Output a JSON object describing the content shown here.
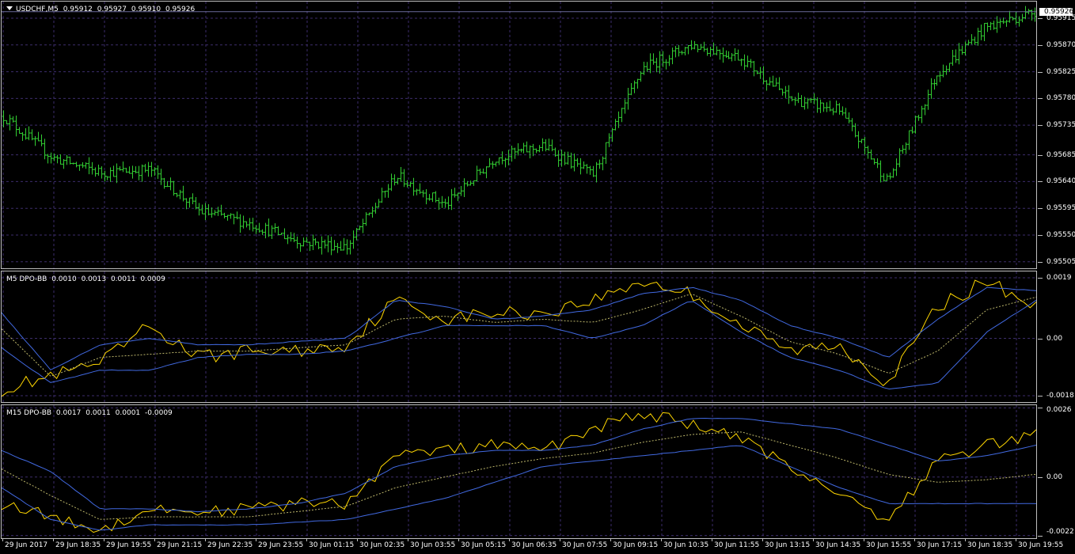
{
  "colors": {
    "background": "#000000",
    "grid": "#3c2d6b",
    "bar": "#32cd32",
    "dpo": "#ffd700",
    "band": "#4169e1",
    "mid": "#bdb76b",
    "frame": "#bfbfbf"
  },
  "main": {
    "symbol_label": "USDCHF,M5",
    "ohlc": [
      "0.95912",
      "0.95927",
      "0.95910",
      "0.95926"
    ],
    "current_price_label": "0.95926",
    "current_price": 0.95926,
    "yticks": [
      "0.95915",
      "0.95870",
      "0.95825",
      "0.95780",
      "0.95735",
      "0.95685",
      "0.95640",
      "0.95595",
      "0.95550",
      "0.95505"
    ],
    "yrange": [
      0.95494,
      0.95943
    ]
  },
  "ind1": {
    "label": "M5 DPO-BB",
    "values": [
      "0.0010",
      "0.0013",
      "0.0011",
      "0.0009"
    ],
    "yticks": [
      "0.0019",
      "0.00",
      "-0.0018"
    ],
    "yrange": [
      -0.002,
      0.0021
    ]
  },
  "ind2": {
    "label": "M15 DPO-BB",
    "values": [
      "0.0017",
      "0.0011",
      "0.0001",
      "-0.0009"
    ],
    "yticks": [
      "0.0026",
      "0.00",
      "-0.0022"
    ],
    "yrange": [
      -0.0023,
      0.0027
    ]
  },
  "xaxis": [
    "29 Jun 2017",
    "29 Jun 18:35",
    "29 Jun 19:55",
    "29 Jun 21:15",
    "29 Jun 22:35",
    "29 Jun 23:55",
    "30 Jun 01:15",
    "30 Jun 02:35",
    "30 Jun 03:55",
    "30 Jun 05:15",
    "30 Jun 06:35",
    "30 Jun 07:55",
    "30 Jun 09:15",
    "30 Jun 10:35",
    "30 Jun 11:55",
    "30 Jun 13:15",
    "30 Jun 14:35",
    "30 Jun 15:55",
    "30 Jun 17:15",
    "30 Jun 18:35",
    "30 Jun 19:55"
  ],
  "chart_data": [
    {
      "type": "bar",
      "title": "USDCHF,M5",
      "x": [
        "29 Jun 2017",
        "29 Jun 18:35",
        "29 Jun 19:55",
        "29 Jun 21:15",
        "29 Jun 22:35",
        "29 Jun 23:55",
        "30 Jun 01:15",
        "30 Jun 02:35",
        "30 Jun 03:55",
        "30 Jun 05:15",
        "30 Jun 06:35",
        "30 Jun 07:55",
        "30 Jun 09:15",
        "30 Jun 10:35",
        "30 Jun 11:55",
        "30 Jun 13:15",
        "30 Jun 14:35",
        "30 Jun 15:55",
        "30 Jun 17:15",
        "30 Jun 18:35",
        "30 Jun 19:55"
      ],
      "close": [
        0.9575,
        0.9568,
        0.95655,
        0.9566,
        0.9559,
        0.9557,
        0.9554,
        0.9553,
        0.9565,
        0.956,
        0.9568,
        0.957,
        0.9565,
        0.9583,
        0.9587,
        0.9585,
        0.9578,
        0.9576,
        0.9564,
        0.9582,
        0.959,
        0.95926
      ],
      "ylim": [
        0.95494,
        0.95943
      ]
    },
    {
      "type": "line",
      "title": "M5 DPO-BB",
      "series": [
        {
          "name": "DPO",
          "values": [
            -0.0016,
            -0.0012,
            -0.0008,
            0.0004,
            -0.0006,
            -0.0004,
            -0.0004,
            -0.0002,
            0.0012,
            0.0006,
            0.0008,
            0.0008,
            0.0012,
            0.0018,
            0.0014,
            0.0004,
            -0.0004,
            -0.0002,
            -0.0014,
            0.001,
            0.0018,
            0.001
          ]
        },
        {
          "name": "Upper",
          "values": [
            0.0008,
            -0.001,
            -0.0002,
            0.0,
            -0.0002,
            -0.0002,
            -0.0001,
            0.0,
            0.0012,
            0.001,
            0.0006,
            0.0007,
            0.0009,
            0.0014,
            0.0016,
            0.0012,
            0.0004,
            0.0,
            -0.0006,
            0.0006,
            0.0016,
            0.0015
          ]
        },
        {
          "name": "Lower",
          "values": [
            -0.0003,
            -0.0014,
            -0.001,
            -0.001,
            -0.0006,
            -0.0005,
            -0.0005,
            -0.0004,
            0.0,
            0.0004,
            0.0004,
            0.0004,
            0.0,
            0.0004,
            0.0012,
            0.0002,
            -0.0006,
            -0.001,
            -0.0016,
            -0.0014,
            0.0002,
            0.0012
          ]
        },
        {
          "name": "Mid",
          "values": [
            0.0003,
            -0.0012,
            -0.0006,
            -0.0005,
            -0.0004,
            -0.0004,
            -0.0003,
            -0.0002,
            0.0006,
            0.0007,
            0.0005,
            0.0006,
            0.0005,
            0.0009,
            0.0014,
            0.0007,
            -0.0001,
            -0.0005,
            -0.0011,
            -0.0004,
            0.0009,
            0.0013
          ]
        }
      ],
      "ylim": [
        -0.002,
        0.0021
      ]
    },
    {
      "type": "line",
      "title": "M15 DPO-BB",
      "series": [
        {
          "name": "DPO",
          "values": [
            -0.001,
            -0.0015,
            -0.002,
            -0.0012,
            -0.0013,
            -0.0012,
            -0.001,
            -0.001,
            0.0008,
            0.001,
            0.0012,
            0.001,
            0.0018,
            0.0024,
            0.002,
            0.0014,
            0.0004,
            -0.0006,
            -0.0016,
            0.0006,
            0.0012,
            0.0016
          ]
        },
        {
          "name": "Upper",
          "values": [
            0.001,
            0.0002,
            -0.0012,
            -0.0012,
            -0.0013,
            -0.0012,
            -0.001,
            -0.0006,
            0.0004,
            0.0008,
            0.001,
            0.001,
            0.0012,
            0.0018,
            0.0022,
            0.0022,
            0.002,
            0.0018,
            0.0012,
            0.0006,
            0.0008,
            0.0012
          ]
        },
        {
          "name": "Lower",
          "values": [
            -0.0004,
            -0.0016,
            -0.002,
            -0.0018,
            -0.0018,
            -0.0018,
            -0.0017,
            -0.0016,
            -0.0012,
            -0.0008,
            -0.0002,
            0.0004,
            0.0006,
            0.0008,
            0.001,
            0.0012,
            0.0004,
            -0.0004,
            -0.001,
            -0.001,
            -0.001,
            -0.001
          ]
        },
        {
          "name": "Mid",
          "values": [
            0.0003,
            -0.0007,
            -0.0016,
            -0.0015,
            -0.0015,
            -0.0015,
            -0.0013,
            -0.0011,
            -0.0004,
            0.0,
            0.0004,
            0.0007,
            0.0009,
            0.0013,
            0.0016,
            0.0017,
            0.0012,
            0.0007,
            0.0001,
            -0.0002,
            -0.0001,
            0.0001
          ]
        }
      ],
      "ylim": [
        -0.0023,
        0.0027
      ]
    }
  ]
}
